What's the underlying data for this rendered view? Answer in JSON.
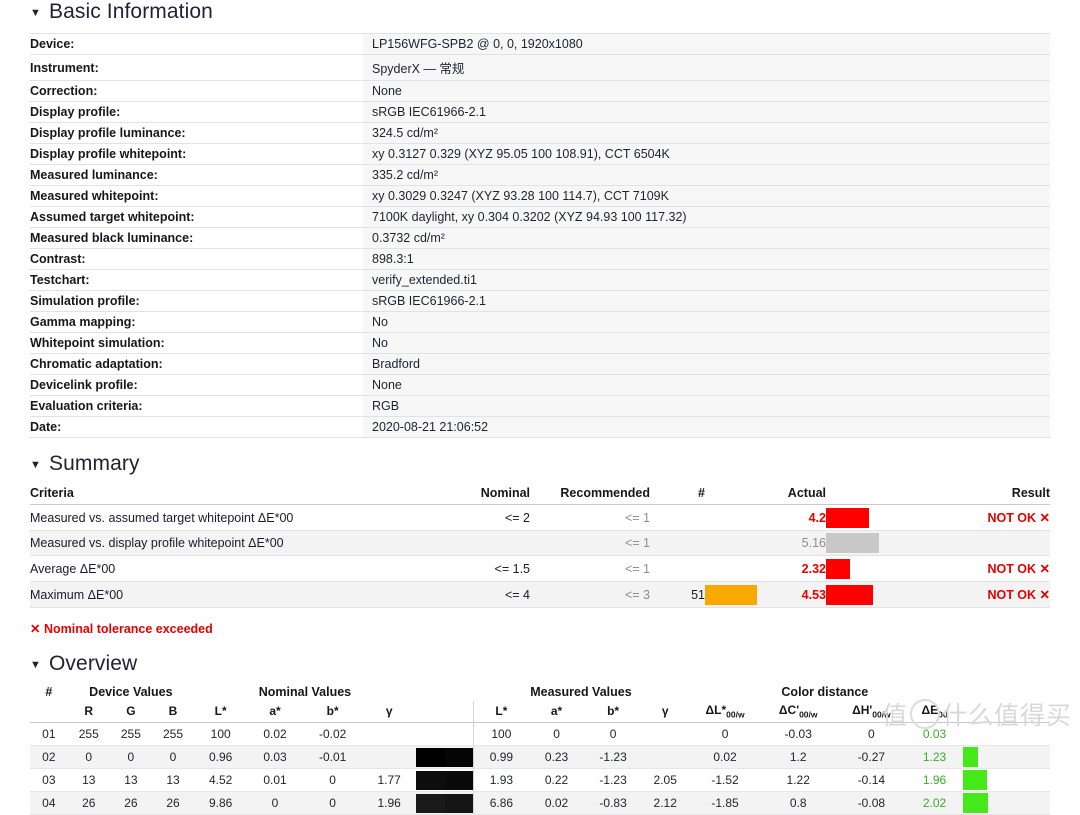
{
  "basic": {
    "title": "Basic Information",
    "rows": [
      {
        "key": "Device:",
        "value": "LP156WFG-SPB2 @ 0, 0, 1920x1080"
      },
      {
        "key": "Instrument:",
        "value": "SpyderX — 常规"
      },
      {
        "key": "Correction:",
        "value": "None"
      },
      {
        "key": "Display profile:",
        "value": "sRGB IEC61966-2.1"
      },
      {
        "key": "Display profile luminance:",
        "value": "324.5 cd/m²"
      },
      {
        "key": "Display profile whitepoint:",
        "value": "xy 0.3127 0.329 (XYZ 95.05 100 108.91), CCT 6504K"
      },
      {
        "key": "Measured luminance:",
        "value": "335.2 cd/m²"
      },
      {
        "key": "Measured whitepoint:",
        "value": "xy 0.3029 0.3247 (XYZ 93.28 100 114.7), CCT 7109K"
      },
      {
        "key": "Assumed target whitepoint:",
        "value": "7100K daylight, xy 0.304 0.3202 (XYZ 94.93 100 117.32)"
      },
      {
        "key": "Measured black luminance:",
        "value": "0.3732 cd/m²"
      },
      {
        "key": "Contrast:",
        "value": "898.3:1"
      },
      {
        "key": "Testchart:",
        "value": "verify_extended.ti1"
      },
      {
        "key": "Simulation profile:",
        "value": "sRGB IEC61966-2.1"
      },
      {
        "key": "Gamma mapping:",
        "value": "No"
      },
      {
        "key": "Whitepoint simulation:",
        "value": "No"
      },
      {
        "key": "Chromatic adaptation:",
        "value": "Bradford"
      },
      {
        "key": "Devicelink profile:",
        "value": "None"
      },
      {
        "key": "Evaluation criteria:",
        "value": "RGB"
      },
      {
        "key": "Date:",
        "value": "2020-08-21 21:06:52"
      }
    ]
  },
  "summary": {
    "title": "Summary",
    "headers": {
      "criteria": "Criteria",
      "nominal": "Nominal",
      "recommended": "Recommended",
      "count": "#",
      "actual": "Actual",
      "result": "Result"
    },
    "rows": [
      {
        "criteria": "Measured vs. assumed target whitepoint ΔE*00",
        "nominal": "<= 2",
        "recommended": "<= 1",
        "count": "",
        "actual": "4.2",
        "result": "NOT OK ✕",
        "actual_bar_color": "#ff0000",
        "actual_bar_width": 43,
        "nominal_bar_color": "",
        "nominal_bar_width": 0,
        "failed": true
      },
      {
        "criteria": "Measured vs. display profile whitepoint ΔE*00",
        "nominal": "",
        "recommended": "<= 1",
        "count": "",
        "actual": "5.16",
        "result": "",
        "actual_bar_color": "#c8c8c8",
        "actual_bar_width": 53,
        "nominal_bar_color": "",
        "nominal_bar_width": 0,
        "failed": false
      },
      {
        "criteria": "Average ΔE*00",
        "nominal": "<= 1.5",
        "recommended": "<= 1",
        "count": "",
        "actual": "2.32",
        "result": "NOT OK ✕",
        "actual_bar_color": "#ff0000",
        "actual_bar_width": 24,
        "nominal_bar_color": "",
        "nominal_bar_width": 0,
        "failed": true
      },
      {
        "criteria": "Maximum ΔE*00",
        "nominal": "<= 4",
        "recommended": "<= 3",
        "count": "51",
        "actual": "4.53",
        "result": "NOT OK ✕",
        "actual_bar_color": "#ff0000",
        "actual_bar_width": 47,
        "nominal_bar_color": "#f9a800",
        "nominal_bar_width": 52,
        "failed": true
      }
    ],
    "warning": "✕ Nominal tolerance exceeded"
  },
  "overview": {
    "title": "Overview",
    "groups": {
      "index": "#",
      "device": "Device Values",
      "nominal": "Nominal Values",
      "measured": "Measured Values",
      "distance": "Color distance"
    },
    "subheaders": {
      "r": "R",
      "g": "G",
      "b": "B",
      "nom_L": "L*",
      "nom_a": "a*",
      "nom_b": "b*",
      "nom_y": "γ",
      "mea_L": "L*",
      "mea_a": "a*",
      "mea_b": "b*",
      "mea_y": "γ",
      "dL": "ΔL*",
      "dC": "ΔC'",
      "dH": "ΔH'",
      "dE": "ΔE",
      "dL_sub": "00/w",
      "dC_sub": "00/w",
      "dH_sub": "00/w",
      "dE_sub": "00"
    },
    "rows": [
      {
        "idx": "01",
        "r": "255",
        "g": "255",
        "b": "255",
        "nom_L": "100",
        "nom_a": "0.02",
        "nom_b": "-0.02",
        "nom_y": "",
        "sw_nominal": "#ffffff",
        "sw_measured": "#ffffff",
        "mea_L": "100",
        "mea_a": "0",
        "mea_b": "0",
        "mea_y": "",
        "dL": "0",
        "dC": "-0.03",
        "dH": "0",
        "dE": "0.03",
        "de_bar_width": 0,
        "de_bar_color": "#45e818"
      },
      {
        "idx": "02",
        "r": "0",
        "g": "0",
        "b": "0",
        "nom_L": "0.96",
        "nom_a": "0.03",
        "nom_b": "-0.01",
        "nom_y": "",
        "sw_nominal": "#000000",
        "sw_measured": "#050505",
        "mea_L": "0.99",
        "mea_a": "0.23",
        "mea_b": "-1.23",
        "mea_y": "",
        "dL": "0.02",
        "dC": "1.2",
        "dH": "-0.27",
        "dE": "1.23",
        "de_bar_width": 15,
        "de_bar_color": "#45e818"
      },
      {
        "idx": "03",
        "r": "13",
        "g": "13",
        "b": "13",
        "nom_L": "4.52",
        "nom_a": "0.01",
        "nom_b": "0",
        "nom_y": "1.77",
        "sw_nominal": "#0d0d0d",
        "sw_measured": "#0a0a0a",
        "mea_L": "1.93",
        "mea_a": "0.22",
        "mea_b": "-1.23",
        "mea_y": "2.05",
        "dL": "-1.52",
        "dC": "1.22",
        "dH": "-0.14",
        "dE": "1.96",
        "de_bar_width": 24,
        "de_bar_color": "#45e818"
      },
      {
        "idx": "04",
        "r": "26",
        "g": "26",
        "b": "26",
        "nom_L": "9.86",
        "nom_a": "0",
        "nom_b": "0",
        "nom_y": "1.96",
        "sw_nominal": "#1a1a1a",
        "sw_measured": "#151515",
        "mea_L": "6.86",
        "mea_a": "0.02",
        "mea_b": "-0.83",
        "mea_y": "2.12",
        "dL": "-1.85",
        "dC": "0.8",
        "dH": "-0.08",
        "dE": "2.02",
        "de_bar_width": 25,
        "de_bar_color": "#45e818"
      }
    ]
  },
  "watermark": {
    "left": "值",
    "right": "什么值得买"
  }
}
